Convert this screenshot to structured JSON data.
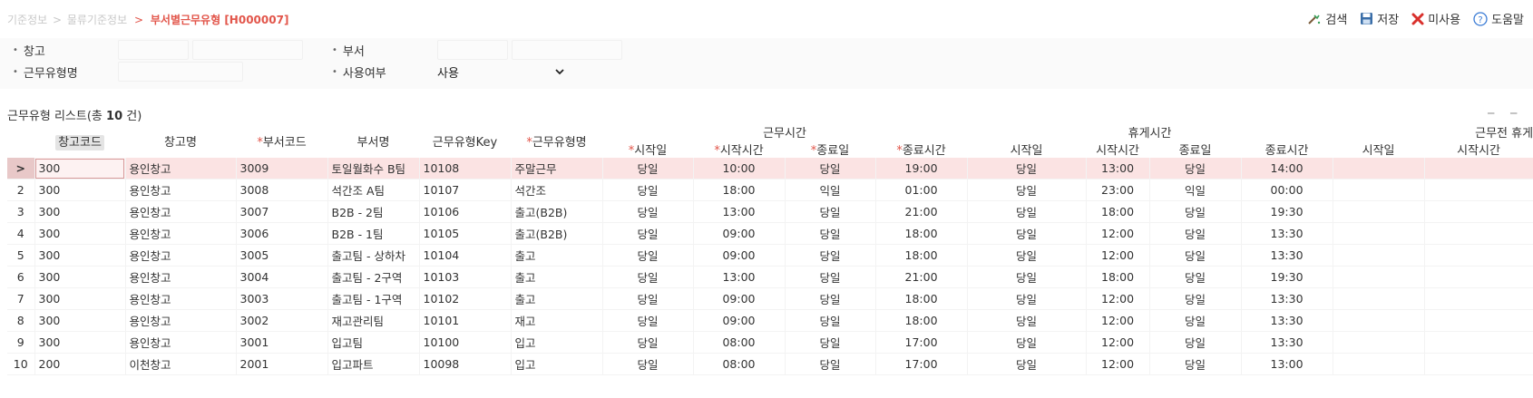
{
  "breadcrumb": {
    "crumbs": [
      "기준정보",
      "물류기준정보"
    ],
    "current": "부서별근무유형 [H000007]"
  },
  "toolbar": {
    "search_label": "검색",
    "save_label": "저장",
    "disable_label": "미사용",
    "help_label": "도움말"
  },
  "search": {
    "warehouse_label": "창고",
    "dept_label": "부서",
    "worktype_label": "근무유형명",
    "usage_label": "사용여부",
    "usage_value": "사용"
  },
  "list": {
    "title_prefix": "근무유형 리스트(총 ",
    "count": "10",
    "title_suffix": " 건)",
    "minimize": "─"
  },
  "grid": {
    "group_headers": {
      "work_time": "근무시간",
      "break_time": "휴게시간",
      "pre_work_break": "근무전 휴게"
    },
    "columns": {
      "wh_code": "창고코드",
      "wh_name": "창고명",
      "dept_code": "부서코드",
      "dept_name": "부서명",
      "worktype_key": "근무유형Key",
      "worktype_name": "근무유형명",
      "work_start_day": "시작일",
      "work_start_time": "시작시간",
      "work_end_day": "종료일",
      "work_end_time": "종료시간",
      "break_start_day": "시작일",
      "break_start_time": "시작시간",
      "break_end_day": "종료일",
      "break_end_time": "종료시간",
      "pre_start_day": "시작일",
      "pre_start_time": "시작시간"
    },
    "required_mark": "*",
    "selected_marker": ">",
    "rows": [
      {
        "no": "1",
        "wh_code": "300",
        "wh_name": "용인창고",
        "dept_code": "3009",
        "dept_name": "토일월화수 B팀",
        "key": "10108",
        "name": "주말근무",
        "ws_day": "당일",
        "ws_time": "10:00",
        "we_day": "당일",
        "we_time": "19:00",
        "bs_day": "당일",
        "bs_time": "13:00",
        "be_day": "당일",
        "be_time": "14:00"
      },
      {
        "no": "2",
        "wh_code": "300",
        "wh_name": "용인창고",
        "dept_code": "3008",
        "dept_name": "석간조 A팀",
        "key": "10107",
        "name": "석간조",
        "ws_day": "당일",
        "ws_time": "18:00",
        "we_day": "익일",
        "we_time": "01:00",
        "bs_day": "당일",
        "bs_time": "23:00",
        "be_day": "익일",
        "be_time": "00:00"
      },
      {
        "no": "3",
        "wh_code": "300",
        "wh_name": "용인창고",
        "dept_code": "3007",
        "dept_name": "B2B - 2팀",
        "key": "10106",
        "name": "출고(B2B)",
        "ws_day": "당일",
        "ws_time": "13:00",
        "we_day": "당일",
        "we_time": "21:00",
        "bs_day": "당일",
        "bs_time": "18:00",
        "be_day": "당일",
        "be_time": "19:30"
      },
      {
        "no": "4",
        "wh_code": "300",
        "wh_name": "용인창고",
        "dept_code": "3006",
        "dept_name": "B2B - 1팀",
        "key": "10105",
        "name": "출고(B2B)",
        "ws_day": "당일",
        "ws_time": "09:00",
        "we_day": "당일",
        "we_time": "18:00",
        "bs_day": "당일",
        "bs_time": "12:00",
        "be_day": "당일",
        "be_time": "13:30"
      },
      {
        "no": "5",
        "wh_code": "300",
        "wh_name": "용인창고",
        "dept_code": "3005",
        "dept_name": "출고팀 - 상하차",
        "key": "10104",
        "name": "출고",
        "ws_day": "당일",
        "ws_time": "09:00",
        "we_day": "당일",
        "we_time": "18:00",
        "bs_day": "당일",
        "bs_time": "12:00",
        "be_day": "당일",
        "be_time": "13:30"
      },
      {
        "no": "6",
        "wh_code": "300",
        "wh_name": "용인창고",
        "dept_code": "3004",
        "dept_name": "출고팀 - 2구역",
        "key": "10103",
        "name": "출고",
        "ws_day": "당일",
        "ws_time": "13:00",
        "we_day": "당일",
        "we_time": "21:00",
        "bs_day": "당일",
        "bs_time": "18:00",
        "be_day": "당일",
        "be_time": "19:30"
      },
      {
        "no": "7",
        "wh_code": "300",
        "wh_name": "용인창고",
        "dept_code": "3003",
        "dept_name": "출고팀 - 1구역",
        "key": "10102",
        "name": "출고",
        "ws_day": "당일",
        "ws_time": "09:00",
        "we_day": "당일",
        "we_time": "18:00",
        "bs_day": "당일",
        "bs_time": "12:00",
        "be_day": "당일",
        "be_time": "13:30"
      },
      {
        "no": "8",
        "wh_code": "300",
        "wh_name": "용인창고",
        "dept_code": "3002",
        "dept_name": "재고관리팀",
        "key": "10101",
        "name": "재고",
        "ws_day": "당일",
        "ws_time": "09:00",
        "we_day": "당일",
        "we_time": "18:00",
        "bs_day": "당일",
        "bs_time": "12:00",
        "be_day": "당일",
        "be_time": "13:30"
      },
      {
        "no": "9",
        "wh_code": "300",
        "wh_name": "용인창고",
        "dept_code": "3001",
        "dept_name": "입고팀",
        "key": "10100",
        "name": "입고",
        "ws_day": "당일",
        "ws_time": "08:00",
        "we_day": "당일",
        "we_time": "17:00",
        "bs_day": "당일",
        "bs_time": "12:00",
        "be_day": "당일",
        "be_time": "13:30"
      },
      {
        "no": "10",
        "wh_code": "200",
        "wh_name": "이천창고",
        "dept_code": "2001",
        "dept_name": "입고파트",
        "key": "10098",
        "name": "입고",
        "ws_day": "당일",
        "ws_time": "08:00",
        "we_day": "당일",
        "we_time": "17:00",
        "bs_day": "당일",
        "bs_time": "12:00",
        "be_day": "당일",
        "be_time": "13:00"
      }
    ]
  },
  "colors": {
    "accent": "#e2554a",
    "selected_row": "#fbe3e3",
    "search_panel_bg": "#fafafa",
    "save_icon": "#3a6ea8",
    "disable_icon": "#d9302c",
    "help_icon": "#3a7bd5"
  }
}
